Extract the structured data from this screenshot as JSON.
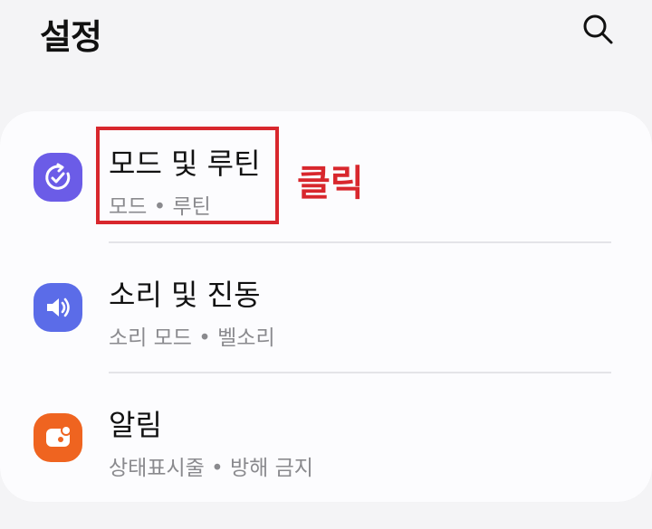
{
  "header": {
    "title": "설정",
    "search_icon": "search-icon"
  },
  "settings": {
    "items": [
      {
        "title": "모드 및 루틴",
        "subtitle": "모드 • 루틴",
        "icon": "modes-routines-icon",
        "icon_color": "#6b5ce7"
      },
      {
        "title": "소리 및 진동",
        "subtitle": "소리 모드 • 벨소리",
        "icon": "speaker-icon",
        "icon_color": "#5b6ce8"
      },
      {
        "title": "알림",
        "subtitle": "상태표시줄 • 방해 금지",
        "icon": "notification-icon",
        "icon_color": "#ef6420"
      }
    ]
  },
  "annotation": {
    "text": "클릭",
    "color": "#d8272d"
  }
}
